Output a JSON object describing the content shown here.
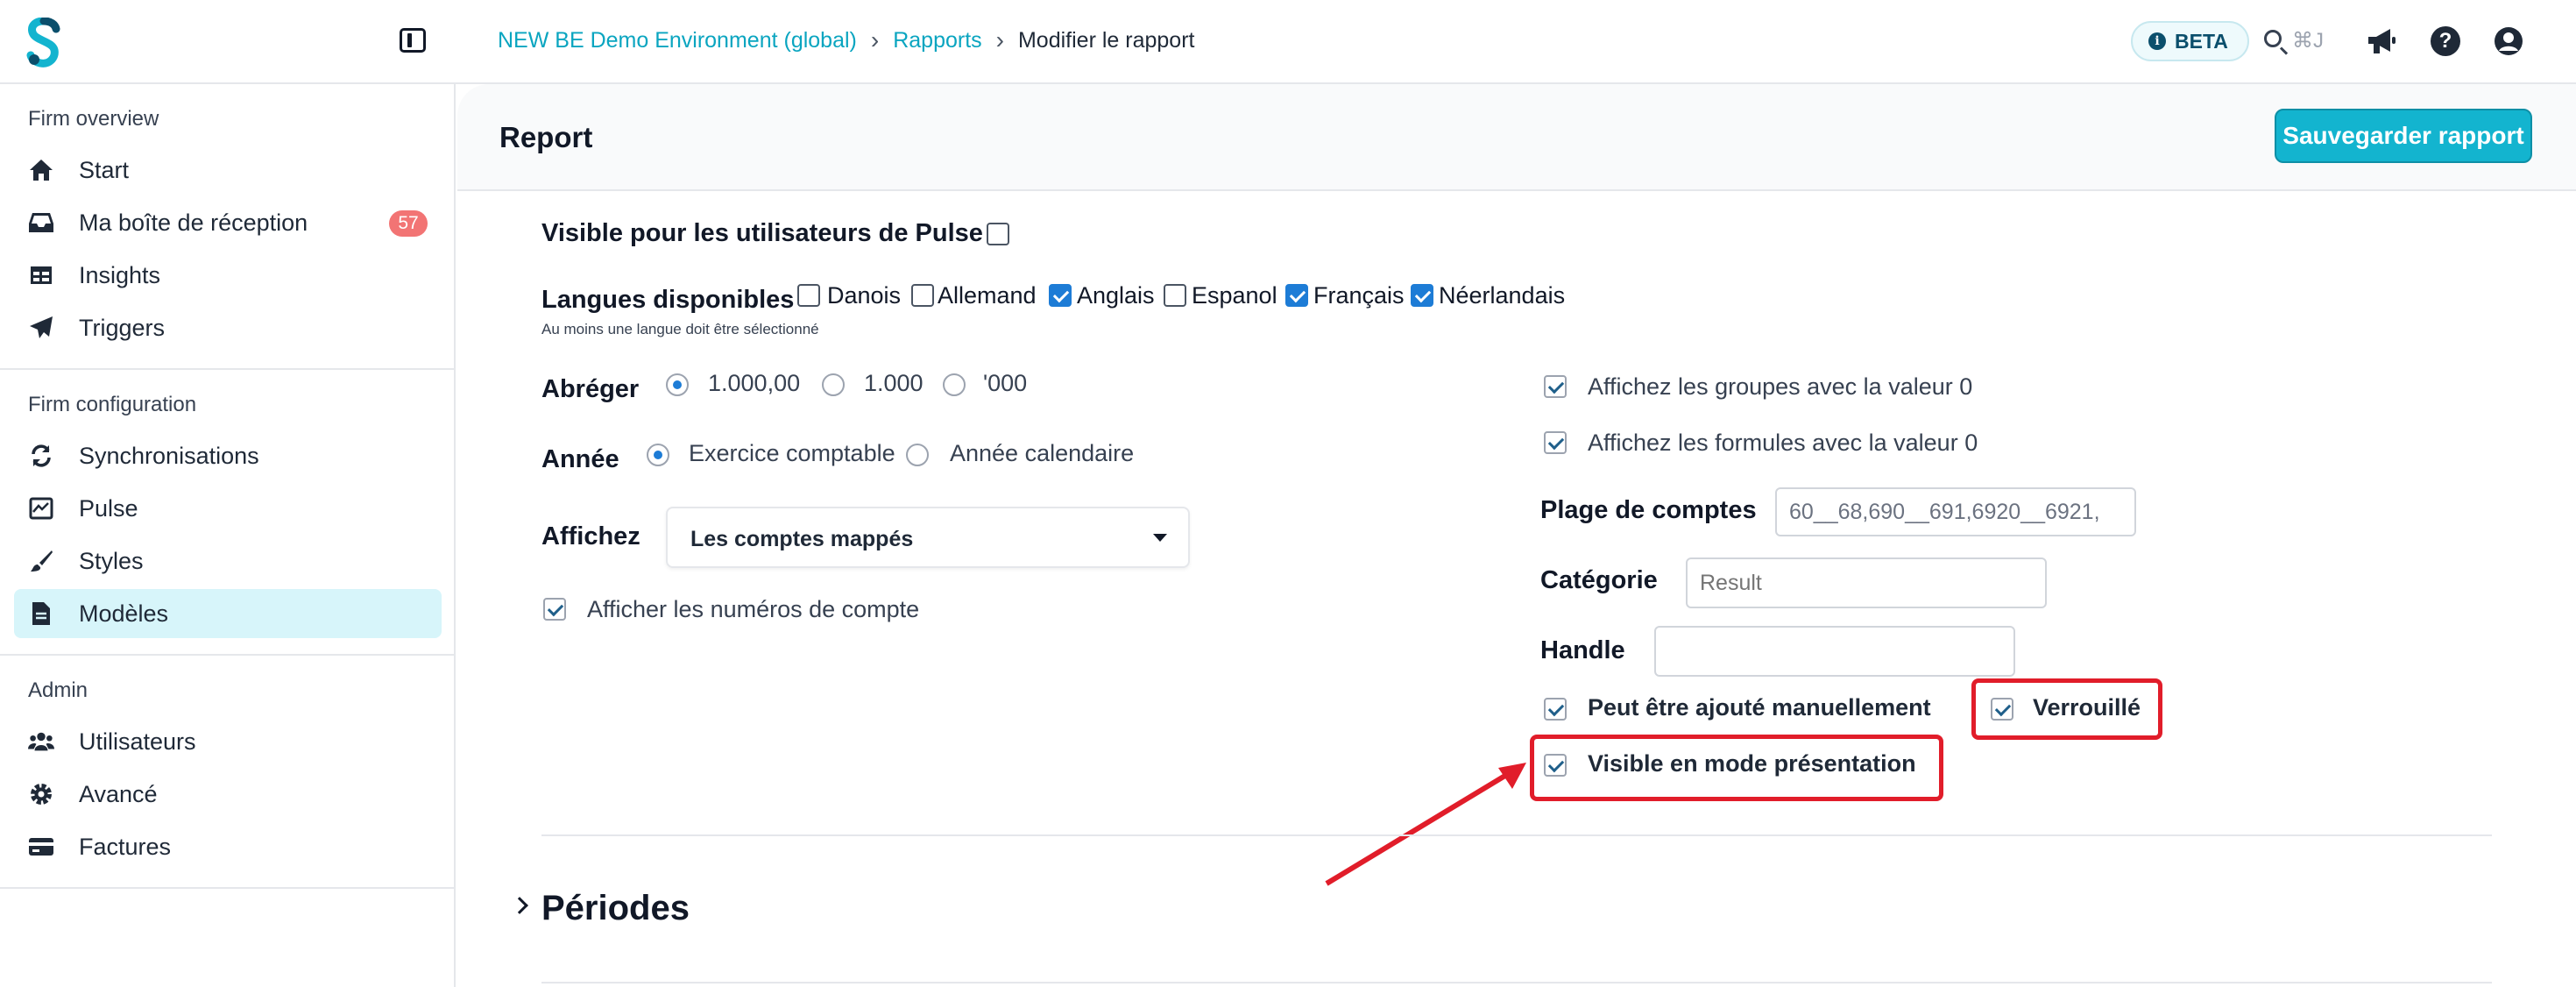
{
  "topbar": {
    "breadcrumb": [
      "NEW BE Demo Environment (global)",
      "Rapports",
      "Modifier le rapport"
    ],
    "beta_label": "BETA",
    "search_shortcut": "⌘J",
    "help_glyph": "?",
    "brand_color": "#13b4cf"
  },
  "sidebar": {
    "sections": [
      {
        "title": "Firm overview",
        "items": [
          {
            "label": "Start",
            "icon": "home-icon"
          },
          {
            "label": "Ma boîte de réception",
            "icon": "inbox-icon",
            "badge": "57"
          },
          {
            "label": "Insights",
            "icon": "table-icon"
          },
          {
            "label": "Triggers",
            "icon": "send-icon"
          }
        ]
      },
      {
        "title": "Firm configuration",
        "items": [
          {
            "label": "Synchronisations",
            "icon": "sync-icon"
          },
          {
            "label": "Pulse",
            "icon": "chart-icon"
          },
          {
            "label": "Styles",
            "icon": "brush-icon"
          },
          {
            "label": "Modèles",
            "icon": "file-icon",
            "active": true
          }
        ]
      },
      {
        "title": "Admin",
        "items": [
          {
            "label": "Utilisateurs",
            "icon": "users-icon"
          },
          {
            "label": "Avancé",
            "icon": "gear-icon"
          },
          {
            "label": "Factures",
            "icon": "card-icon"
          }
        ]
      }
    ]
  },
  "header": {
    "title": "Report",
    "save_label": "Sauvegarder rapport"
  },
  "form": {
    "visible_pulse_label": "Visible pour les utilisateurs de Pulse",
    "visible_pulse_checked": false,
    "langues_label": "Langues disponibles",
    "langues_hint": "Au moins une langue doit être sélectionné",
    "langues": [
      {
        "label": "Danois",
        "checked": false
      },
      {
        "label": "Allemand",
        "checked": false
      },
      {
        "label": "Anglais",
        "checked": true
      },
      {
        "label": "Espanol",
        "checked": false
      },
      {
        "label": "Français",
        "checked": true
      },
      {
        "label": "Néerlandais",
        "checked": true
      }
    ],
    "abreger_label": "Abréger",
    "abreger_options": [
      "1.000,00",
      "1.000",
      "'000"
    ],
    "abreger_selected": "1.000,00",
    "annee_label": "Année",
    "annee_options": [
      "Exercice comptable",
      "Année calendaire"
    ],
    "annee_selected": "Exercice comptable",
    "affichez_label": "Affichez",
    "affichez_value": "Les comptes mappés",
    "afficher_numeros_label": "Afficher les numéros de compte",
    "afficher_numeros_checked": true,
    "groupes_zero_label": "Affichez les groupes avec la valeur 0",
    "groupes_zero_checked": true,
    "formules_zero_label": "Affichez les formules avec la valeur 0",
    "formules_zero_checked": true,
    "plage_label": "Plage de comptes",
    "plage_value": "60__68,690__691,6920__6921,",
    "categorie_label": "Catégorie",
    "categorie_placeholder": "Result",
    "handle_label": "Handle",
    "handle_value": "",
    "manuel_label": "Peut être ajouté manuellement",
    "manuel_checked": true,
    "verrouille_label": "Verrouillé",
    "verrouille_checked": true,
    "presentation_label": "Visible en mode présentation",
    "presentation_checked": true
  },
  "periodes": {
    "title": "Périodes"
  },
  "annotation_color": "#e11d2a"
}
